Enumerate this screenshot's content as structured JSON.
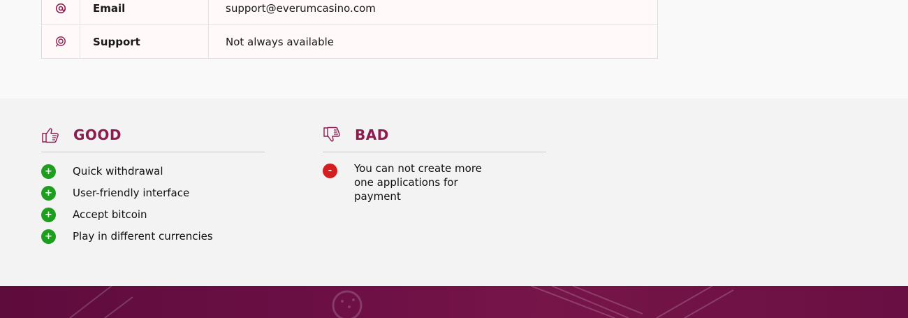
{
  "info_table": {
    "rows": [
      {
        "icon": "at-sign-icon",
        "label": "Email",
        "value": "support@everumcasino.com"
      },
      {
        "icon": "headset-icon",
        "label": "Support",
        "value": "Not always available"
      }
    ]
  },
  "pros_cons": {
    "good": {
      "title": "GOOD",
      "icon": "thumbs-up-icon",
      "badge": "+",
      "items": [
        "Quick withdrawal",
        "User-friendly interface",
        "Accept bitcoin",
        "Play in different currencies"
      ]
    },
    "bad": {
      "title": "BAD",
      "icon": "thumbs-down-icon",
      "badge": "-",
      "items": [
        "You can not create more one applications for payment"
      ]
    }
  },
  "colors": {
    "accent": "#8c1c4f",
    "good_badge": "#1e9e1e",
    "bad_badge": "#d31f1f",
    "footer": "#6b0f45"
  }
}
